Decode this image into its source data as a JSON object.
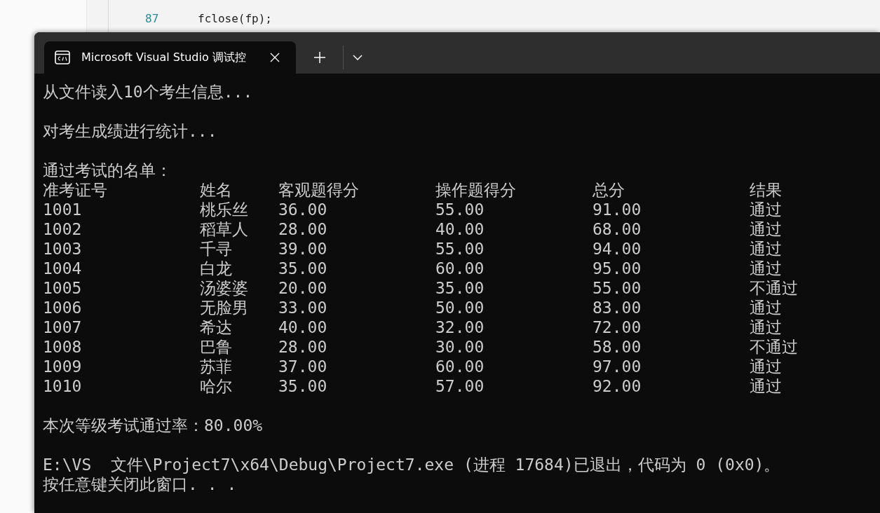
{
  "editor": {
    "line_number": "87",
    "code": "fclose(fp);"
  },
  "terminal": {
    "tab": {
      "title": "Microsoft Visual Studio 调试控",
      "selected": true
    },
    "blocks": [
      {
        "kind": "line",
        "text": "从文件读入10个考生信息..."
      },
      {
        "kind": "blank"
      },
      {
        "kind": "line",
        "text": "对考生成绩进行统计..."
      },
      {
        "kind": "blank"
      },
      {
        "kind": "line",
        "text": "通过考试的名单："
      },
      {
        "kind": "table",
        "columns": [
          "准考证号",
          "姓名",
          "客观题得分",
          "操作题得分",
          "总分",
          "结果"
        ],
        "rows": [
          [
            "1001",
            "桃乐丝",
            "36.00",
            "55.00",
            "91.00",
            "通过"
          ],
          [
            "1002",
            "稻草人",
            "28.00",
            "40.00",
            "68.00",
            "通过"
          ],
          [
            "1003",
            "千寻",
            "39.00",
            "55.00",
            "94.00",
            "通过"
          ],
          [
            "1004",
            "白龙",
            "35.00",
            "60.00",
            "95.00",
            "通过"
          ],
          [
            "1005",
            "汤婆婆",
            "20.00",
            "35.00",
            "55.00",
            "不通过"
          ],
          [
            "1006",
            "无脸男",
            "33.00",
            "50.00",
            "83.00",
            "通过"
          ],
          [
            "1007",
            "希达",
            "40.00",
            "32.00",
            "72.00",
            "通过"
          ],
          [
            "1008",
            "巴鲁",
            "28.00",
            "30.00",
            "58.00",
            "不通过"
          ],
          [
            "1009",
            "苏菲",
            "37.00",
            "60.00",
            "97.00",
            "通过"
          ],
          [
            "1010",
            "哈尔",
            "35.00",
            "57.00",
            "92.00",
            "通过"
          ]
        ]
      },
      {
        "kind": "blank"
      },
      {
        "kind": "line",
        "text": "本次等级考试通过率：80.00%"
      },
      {
        "kind": "blank"
      },
      {
        "kind": "line",
        "text": "E:\\VS  文件\\Project7\\x64\\Debug\\Project7.exe (进程 17684)已退出，代码为 0 (0x0)。"
      },
      {
        "kind": "line",
        "text": "按任意键关闭此窗口. . ."
      }
    ]
  }
}
